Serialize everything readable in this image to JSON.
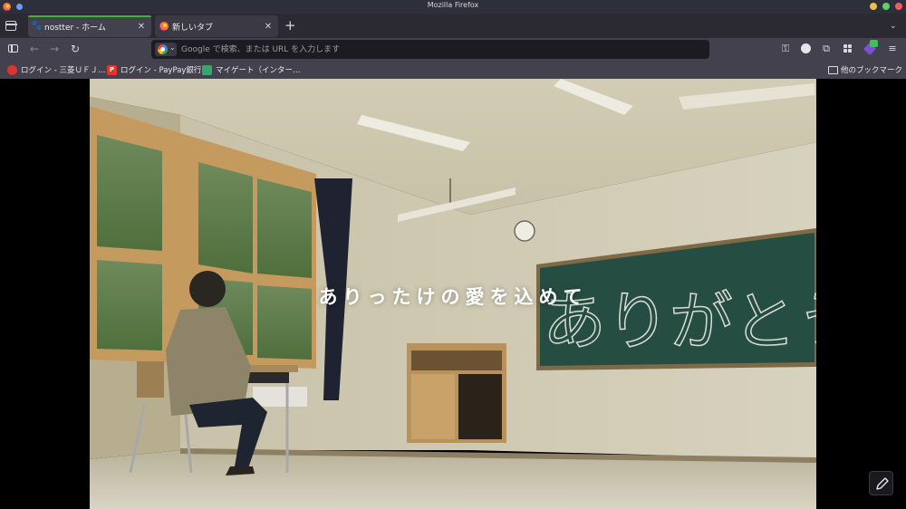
{
  "window": {
    "title": "Mozilla Firefox"
  },
  "tabs": [
    {
      "label": "nostter - ホーム",
      "favicon": "paw-icon",
      "active": true
    },
    {
      "label": "新しいタブ",
      "favicon": "firefox-icon",
      "active": false
    }
  ],
  "navbar": {
    "url_placeholder": "Google で検索、または URL を入力します",
    "search_engine": "Google"
  },
  "bookmarks": [
    {
      "label": "ログイン - 三菱ＵＦＪ…",
      "icon": "mufg-icon"
    },
    {
      "label": "ログイン - PayPay銀行",
      "icon": "paypay-icon"
    },
    {
      "label": "マイゲート（インター…",
      "icon": "mygate-icon"
    }
  ],
  "bookmarks_other": "他のブックマーク",
  "content": {
    "overlay_text": "ありったけの愛を込めて",
    "chalkboard_text": "ありがとう"
  },
  "colors": {
    "accent_tab": "#3eb33e",
    "toolbar": "#42414d",
    "tabstrip": "#2b2a33",
    "urlbar": "#1c1b22"
  }
}
